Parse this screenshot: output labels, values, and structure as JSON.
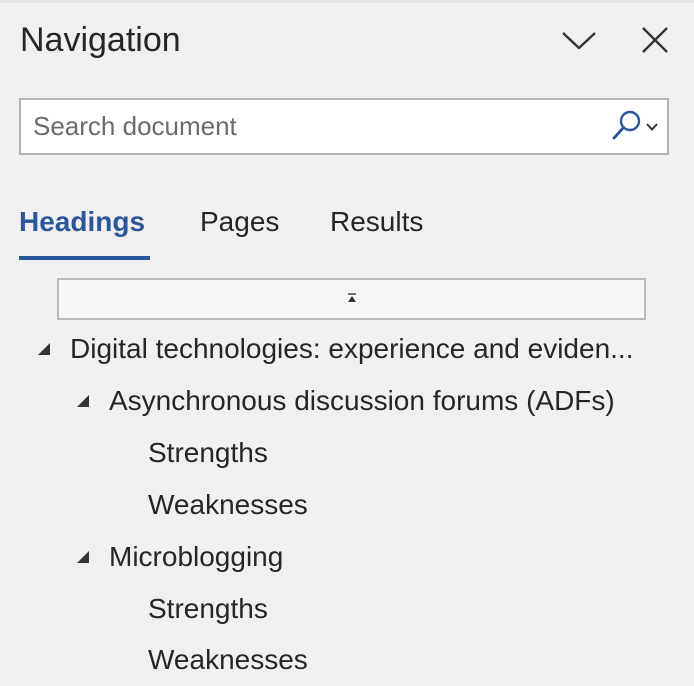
{
  "pane": {
    "title": "Navigation",
    "options_icon": "chevron-down-icon",
    "close_icon": "close-icon"
  },
  "search": {
    "placeholder": "Search document",
    "value": "",
    "icon": "search-icon",
    "dropdown_icon": "chevron-down-small-icon"
  },
  "tabs": [
    {
      "label": "Headings",
      "active": true
    },
    {
      "label": "Pages",
      "active": false
    },
    {
      "label": "Results",
      "active": false
    }
  ],
  "scroll_top_icon": "jump-to-top-icon",
  "headings": [
    {
      "level": 1,
      "label": "Digital technologies: experience and eviden...",
      "expanded": true
    },
    {
      "level": 2,
      "label": "Asynchronous discussion forums (ADFs)",
      "expanded": true
    },
    {
      "level": 3,
      "label": "Strengths"
    },
    {
      "level": 3,
      "label": "Weaknesses"
    },
    {
      "level": 2,
      "label": "Microblogging",
      "expanded": true
    },
    {
      "level": 3,
      "label": "Strengths"
    },
    {
      "level": 3,
      "label": "Weaknesses"
    }
  ],
  "colors": {
    "accent": "#2b579a",
    "background": "#f0f0f0",
    "text": "#262626"
  }
}
